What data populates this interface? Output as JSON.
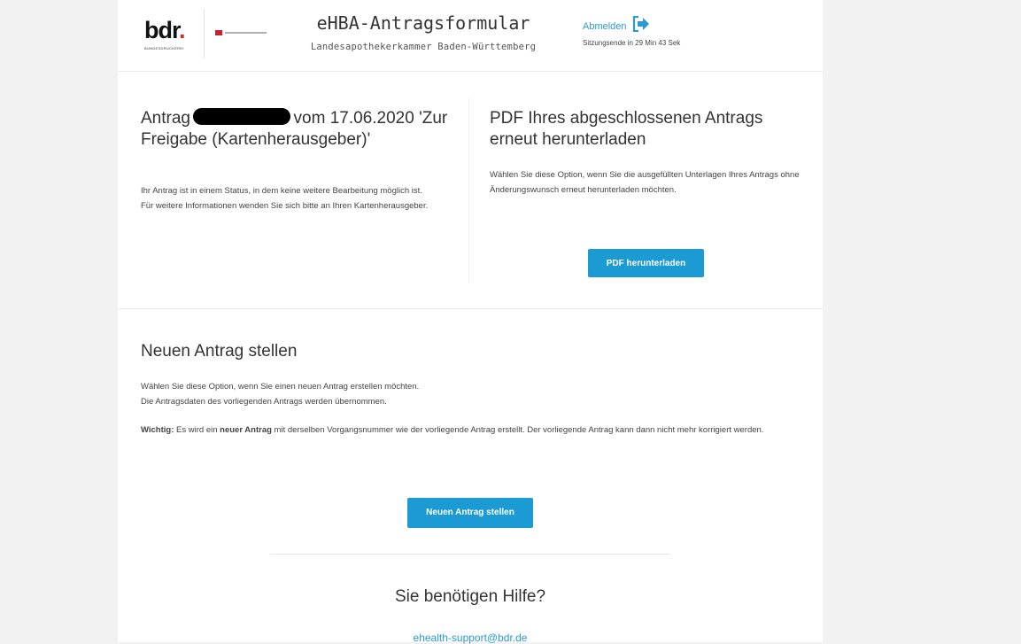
{
  "header": {
    "logo_text": "bdr.",
    "logo_subtext": "BUNDESDRUCKEREI",
    "title": "eHBA-Antragsformular",
    "subtitle": "Landesapothekerkammer Baden-Württemberg",
    "logout_label": "Abmelden",
    "session_text": "Sitzungsende in 29 Min 43 Sek",
    "logout_icon": "sign-out-icon"
  },
  "status_section": {
    "title_prefix": "Antrag",
    "title_suffix": "vom 17.06.2020 'Zur Freigabe (Kartenherausgeber)'",
    "line1": "Ihr Antrag ist in einem Status, in dem keine weitere Bearbeitung möglich ist.",
    "line2": "Für weitere Informationen wenden Sie sich bitte an Ihren Kartenherausgeber."
  },
  "pdf_section": {
    "title": "PDF Ihres abgeschlossenen Antrags erneut herunterladen",
    "text": "Wählen Sie diese Option, wenn Sie die ausgefüllten Unterlagen Ihres Antrags ohne Änderungswunsch erneut herunterladen möchten.",
    "button_label": "PDF herunterladen"
  },
  "new_section": {
    "title": "Neuen Antrag stellen",
    "text1": "Wählen Sie diese Option, wenn Sie einen neuen Antrag erstellen möchten.",
    "text2": "Die Antragsdaten des vorliegenden Antrags werden übernommen.",
    "important_label": "Wichtig:",
    "important_part1": " Es wird ein ",
    "important_bold": "neuer Antrag",
    "important_part2": " mit derselben Vorgangsnummer wie der vorliegende Antrag erstellt. Der vorliegende Antrag kann dann nicht mehr korrigiert werden.",
    "button_label": "Neuen Antrag stellen"
  },
  "help": {
    "title": "Sie benötigen Hilfe?",
    "email": "ehealth-support@bdr.de"
  },
  "colors": {
    "accent": "#1b9ad3",
    "link": "#2a9ad6",
    "brand_red": "#d62828"
  }
}
